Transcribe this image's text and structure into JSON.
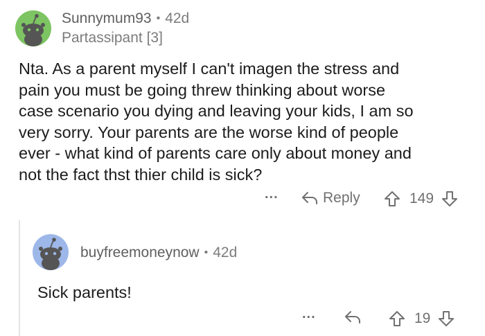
{
  "comment": {
    "username": "Sunnymum93",
    "separator": "•",
    "age": "42d",
    "flair": "Partassipant [3]",
    "body_lines": [
      "Nta. As a parent myself I can't imagen the stress and",
      "pain you must be going threw thinking about worse",
      "case scenario you dying and leaving your kids, I am so",
      "very sorry. Your parents are the worse kind of people",
      "ever - what kind of parents care only about money and",
      "not the fact thst thier child is sick?"
    ],
    "more_label": "...",
    "reply_label": "Reply",
    "score": "149",
    "avatar_color": "#7dc462"
  },
  "reply": {
    "username": "buyfreemoneynow",
    "separator": "•",
    "age": "42d",
    "body": "Sick parents!",
    "more_label": "...",
    "score": "19",
    "avatar_color": "#9db7e9"
  },
  "icons": {
    "reply": "reply-arrow-icon",
    "upvote": "upvote-arrow-icon",
    "downvote": "downvote-arrow-icon",
    "more": "more-options-icon"
  }
}
